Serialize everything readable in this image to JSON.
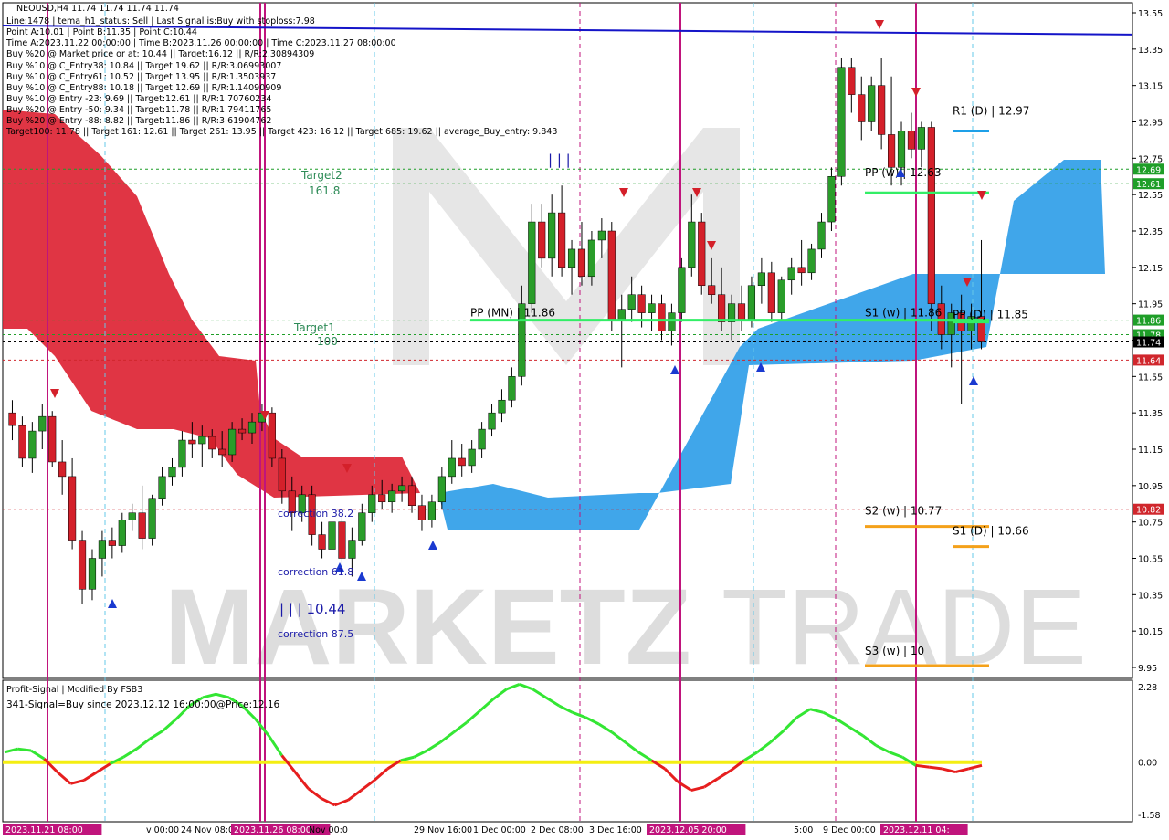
{
  "header": {
    "symbol_line": "NEOUSD,H4  11.74 11.74 11.74 11.74",
    "info_lines": [
      "Line:1478  |  tema_h1_status: Sell  |  Last Signal is:Buy with stoploss:7.98",
      "Point A:10.01  |  Point B:11.35  |  Point C:10.44",
      "Time A:2023.11.22 00:00:00  |  Time B:2023.11.26 00:00:00  |  Time C:2023.11.27 08:00:00",
      "Buy %20 @ Market price or at: 10.44  ||  Target:16.12  ||  R/R:2.30894309",
      "Buy %10 @ C_Entry38: 10.84  ||  Target:19.62  ||  R/R:3.06993007",
      "Buy %10 @ C_Entry61: 10.52  ||  Target:13.95  ||  R/R:1.3503937",
      "Buy %10 @ C_Entry88: 10.18  ||  Target:12.69  ||  R/R:1.14090909",
      "Buy %10 @ Entry -23: 9.69  ||  Target:12.61  ||  R/R:1.70760234",
      "Buy %20 @ Entry -50: 9.34  ||  Target:11.78  ||  R/R:1.79411765",
      "Buy %20 @ Entry -88: 8.82  ||  Target:11.86  ||  R/R:3.61904762",
      "Target100: 11.78  ||  Target 161: 12.61  ||  Target 261: 13.95  ||  Target 423: 16.12  ||  Target 685: 19.62  ||  average_Buy_entry: 9.843"
    ]
  },
  "watermark": {
    "left": "MARKETZ",
    "right": "TRADE"
  },
  "chart_data": [
    {
      "type": "candlestick",
      "title": "NEOUSD,H4",
      "ylim": [
        9.9,
        13.6
      ],
      "y_ticks": [
        "13.55",
        "13.35",
        "13.15",
        "12.95",
        "12.75",
        "12.55",
        "12.35",
        "12.15",
        "11.95",
        "11.75",
        "11.55",
        "11.35",
        "11.15",
        "10.95",
        "10.75",
        "10.55",
        "10.35",
        "10.15",
        "9.95"
      ],
      "x_labels": [
        "2023.11.21 08:00",
        "v 00:00",
        "24 Nov 08:00",
        "2023.11.26 08:00",
        "Nov 00:0",
        "29 Nov 16:00",
        "1 Dec 00:00",
        "2 Dec 08:00",
        "3 Dec 16:00",
        "2023.12.05 20:00",
        "5:00",
        "9 Dec 00:00",
        "2023.12.11 04:"
      ],
      "price_tags": [
        {
          "value": 12.69,
          "label": "12.69",
          "color": "#1e9e28"
        },
        {
          "value": 12.61,
          "label": "12.61",
          "color": "#1e9e28"
        },
        {
          "value": 11.86,
          "label": "11.86",
          "color": "#1e9e28"
        },
        {
          "value": 11.78,
          "label": "11.78",
          "color": "#1e9e28"
        },
        {
          "value": 11.74,
          "label": "11.74",
          "color": "#000000"
        },
        {
          "value": 11.64,
          "label": "11.64",
          "color": "#d0262c"
        },
        {
          "value": 10.82,
          "label": "10.82",
          "color": "#d0262c"
        }
      ],
      "levels": [
        {
          "label": "R1 (D) | 12.97",
          "value": 12.97,
          "color": "#1ea0e8"
        },
        {
          "label": "PP (w) | 12.63",
          "value": 12.63,
          "color": "#33ee66"
        },
        {
          "label": "PP (MN) | 11.86",
          "value": 11.86,
          "color": "#33ee66"
        },
        {
          "label": "S1 (w) | 11.86",
          "value": 11.86,
          "color": "#33ee66"
        },
        {
          "label": "PP (D) | 11.85",
          "value": 11.85,
          "color": "#33ee66"
        },
        {
          "label": "S2 (w) | 10.77",
          "value": 10.77,
          "color": "#f4a11a"
        },
        {
          "label": "S1 (D) | 10.66",
          "value": 10.66,
          "color": "#f4a11a"
        },
        {
          "label": "S3 (w) | 10",
          "value": 10.0,
          "color": "#f4a11a"
        }
      ],
      "annotations": [
        "Target2",
        "161.8",
        "Target1",
        "100",
        "correction 38.2",
        "correction 61.8",
        "correction 87.5",
        "| | | 10.44",
        "| | |"
      ],
      "candles": [
        [
          11.35,
          11.42,
          11.2,
          11.28
        ],
        [
          11.28,
          11.33,
          11.05,
          11.1
        ],
        [
          11.1,
          11.3,
          11.02,
          11.25
        ],
        [
          11.25,
          11.4,
          11.15,
          11.33
        ],
        [
          11.33,
          11.36,
          11.05,
          11.08
        ],
        [
          11.08,
          11.2,
          10.9,
          11.0
        ],
        [
          11.0,
          11.1,
          10.6,
          10.65
        ],
        [
          10.65,
          10.7,
          10.3,
          10.38
        ],
        [
          10.38,
          10.6,
          10.32,
          10.55
        ],
        [
          10.55,
          10.7,
          10.45,
          10.65
        ],
        [
          10.65,
          10.72,
          10.55,
          10.62
        ],
        [
          10.62,
          10.8,
          10.58,
          10.76
        ],
        [
          10.76,
          10.85,
          10.7,
          10.8
        ],
        [
          10.8,
          10.95,
          10.6,
          10.66
        ],
        [
          10.66,
          10.9,
          10.62,
          10.88
        ],
        [
          10.88,
          11.05,
          10.84,
          11.0
        ],
        [
          11.0,
          11.1,
          10.95,
          11.05
        ],
        [
          11.05,
          11.25,
          11.0,
          11.2
        ],
        [
          11.2,
          11.3,
          11.1,
          11.18
        ],
        [
          11.18,
          11.28,
          11.05,
          11.22
        ],
        [
          11.22,
          11.26,
          11.1,
          11.15
        ],
        [
          11.15,
          11.25,
          11.05,
          11.12
        ],
        [
          11.12,
          11.3,
          11.08,
          11.26
        ],
        [
          11.26,
          11.32,
          11.2,
          11.24
        ],
        [
          11.24,
          11.35,
          11.18,
          11.3
        ],
        [
          11.3,
          11.4,
          11.25,
          11.35
        ],
        [
          11.35,
          11.38,
          11.05,
          11.1
        ],
        [
          11.1,
          11.15,
          10.85,
          10.92
        ],
        [
          10.92,
          11.0,
          10.7,
          10.8
        ],
        [
          10.8,
          10.95,
          10.75,
          10.9
        ],
        [
          10.9,
          10.95,
          10.62,
          10.68
        ],
        [
          10.68,
          10.75,
          10.55,
          10.6
        ],
        [
          10.6,
          10.8,
          10.58,
          10.75
        ],
        [
          10.75,
          10.8,
          10.5,
          10.55
        ],
        [
          10.55,
          10.72,
          10.45,
          10.65
        ],
        [
          10.65,
          10.85,
          10.62,
          10.8
        ],
        [
          10.8,
          10.95,
          10.75,
          10.9
        ],
        [
          10.9,
          10.98,
          10.82,
          10.86
        ],
        [
          10.86,
          10.96,
          10.8,
          10.92
        ],
        [
          10.92,
          11.0,
          10.86,
          10.95
        ],
        [
          10.95,
          11.0,
          10.8,
          10.84
        ],
        [
          10.84,
          10.9,
          10.7,
          10.76
        ],
        [
          10.76,
          10.9,
          10.72,
          10.86
        ],
        [
          10.86,
          11.05,
          10.82,
          11.0
        ],
        [
          11.0,
          11.2,
          10.96,
          11.1
        ],
        [
          11.1,
          11.18,
          11.0,
          11.06
        ],
        [
          11.06,
          11.2,
          11.02,
          11.15
        ],
        [
          11.15,
          11.3,
          11.1,
          11.26
        ],
        [
          11.26,
          11.4,
          11.22,
          11.35
        ],
        [
          11.35,
          11.48,
          11.3,
          11.42
        ],
        [
          11.42,
          11.6,
          11.38,
          11.55
        ],
        [
          11.55,
          12.05,
          11.5,
          11.95
        ],
        [
          11.95,
          12.5,
          11.9,
          12.4
        ],
        [
          12.4,
          12.5,
          12.15,
          12.2
        ],
        [
          12.2,
          12.55,
          12.1,
          12.45
        ],
        [
          12.45,
          12.6,
          12.1,
          12.15
        ],
        [
          12.15,
          12.3,
          12.0,
          12.25
        ],
        [
          12.25,
          12.4,
          12.05,
          12.1
        ],
        [
          12.1,
          12.35,
          12.05,
          12.3
        ],
        [
          12.3,
          12.42,
          12.2,
          12.35
        ],
        [
          12.35,
          12.4,
          11.8,
          11.86
        ],
        [
          11.86,
          12.0,
          11.6,
          11.92
        ],
        [
          11.92,
          12.1,
          11.85,
          12.0
        ],
        [
          12.0,
          12.05,
          11.82,
          11.9
        ],
        [
          11.9,
          12.0,
          11.8,
          11.95
        ],
        [
          11.95,
          12.0,
          11.75,
          11.8
        ],
        [
          11.8,
          11.95,
          11.72,
          11.9
        ],
        [
          11.9,
          12.2,
          11.85,
          12.15
        ],
        [
          12.15,
          12.55,
          12.1,
          12.4
        ],
        [
          12.4,
          12.45,
          12.0,
          12.05
        ],
        [
          12.05,
          12.2,
          11.95,
          12.0
        ],
        [
          12.0,
          12.15,
          11.8,
          11.85
        ],
        [
          11.85,
          12.0,
          11.75,
          11.95
        ],
        [
          11.95,
          12.05,
          11.8,
          11.86
        ],
        [
          11.86,
          12.1,
          11.82,
          12.05
        ],
        [
          12.05,
          12.2,
          11.95,
          12.12
        ],
        [
          12.12,
          12.18,
          11.85,
          11.9
        ],
        [
          11.9,
          12.1,
          11.86,
          12.08
        ],
        [
          12.08,
          12.2,
          12.0,
          12.15
        ],
        [
          12.15,
          12.3,
          12.05,
          12.12
        ],
        [
          12.12,
          12.28,
          12.08,
          12.25
        ],
        [
          12.25,
          12.45,
          12.2,
          12.4
        ],
        [
          12.4,
          12.7,
          12.35,
          12.65
        ],
        [
          12.65,
          13.3,
          12.6,
          13.25
        ],
        [
          13.25,
          13.3,
          13.0,
          13.1
        ],
        [
          13.1,
          13.2,
          12.85,
          12.95
        ],
        [
          12.95,
          13.2,
          12.9,
          13.15
        ],
        [
          13.15,
          13.3,
          12.8,
          12.88
        ],
        [
          12.88,
          13.2,
          12.6,
          12.7
        ],
        [
          12.7,
          12.95,
          12.6,
          12.9
        ],
        [
          12.9,
          13.0,
          12.75,
          12.8
        ],
        [
          12.8,
          12.95,
          12.7,
          12.92
        ],
        [
          12.92,
          12.95,
          11.8,
          11.95
        ],
        [
          11.95,
          12.05,
          11.7,
          11.78
        ],
        [
          11.78,
          11.95,
          11.6,
          11.9
        ],
        [
          11.9,
          12.0,
          11.4,
          11.8
        ],
        [
          11.8,
          11.95,
          11.7,
          11.88
        ],
        [
          11.88,
          12.3,
          11.7,
          11.74
        ]
      ]
    },
    {
      "type": "line",
      "title": "Profit-Signal | Modified By FSB3",
      "subtitle": "341-Signal=Buy since 2023.12.12 16:00:00@Price:12.16",
      "ylim": [
        -1.58,
        2.28
      ],
      "y_ticks": [
        "2.28",
        "0.00",
        "-1.58"
      ],
      "values": [
        0.3,
        0.4,
        0.35,
        0.1,
        -0.3,
        -0.65,
        -0.55,
        -0.3,
        -0.05,
        0.15,
        0.4,
        0.7,
        0.95,
        1.3,
        1.7,
        1.95,
        2.05,
        1.95,
        1.7,
        1.3,
        0.8,
        0.2,
        -0.3,
        -0.8,
        -1.1,
        -1.3,
        -1.15,
        -0.85,
        -0.55,
        -0.2,
        0.05,
        0.15,
        0.35,
        0.6,
        0.9,
        1.2,
        1.55,
        1.9,
        2.2,
        2.35,
        2.2,
        1.95,
        1.7,
        1.5,
        1.35,
        1.15,
        0.9,
        0.6,
        0.3,
        0.05,
        -0.2,
        -0.6,
        -0.85,
        -0.75,
        -0.5,
        -0.25,
        0.05,
        0.3,
        0.6,
        0.95,
        1.35,
        1.6,
        1.5,
        1.3,
        1.05,
        0.8,
        0.5,
        0.3,
        0.15,
        -0.1,
        -0.15,
        -0.2,
        -0.3,
        -0.2,
        -0.1
      ]
    }
  ]
}
